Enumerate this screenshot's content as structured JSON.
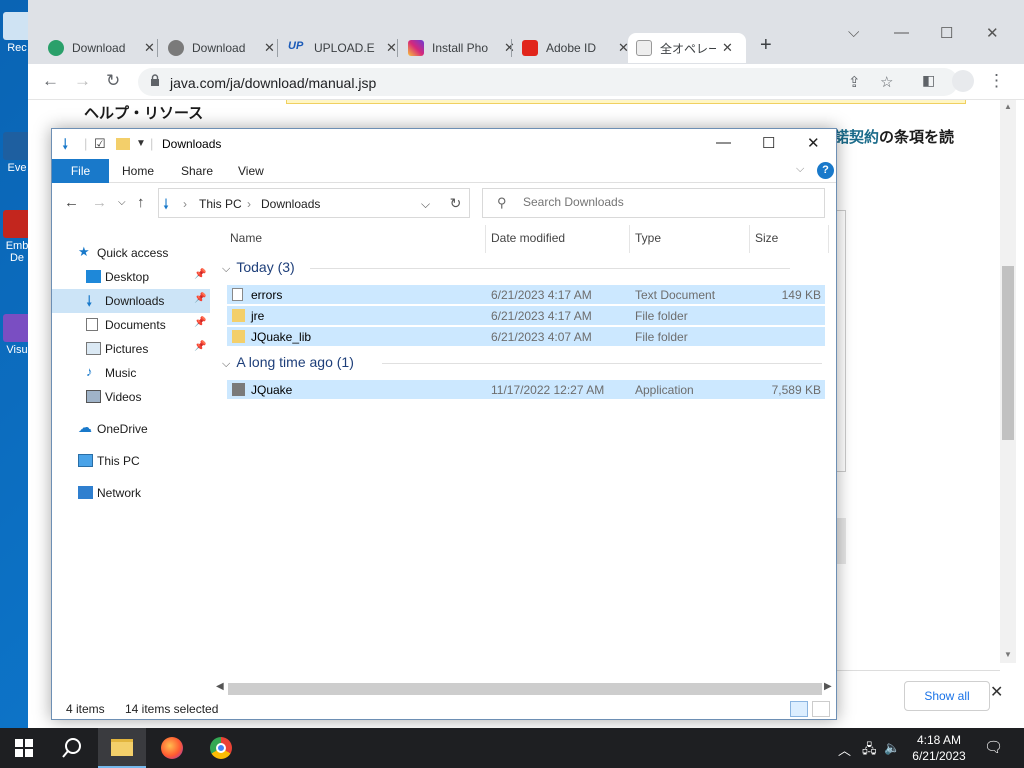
{
  "desktop": {
    "icons": [
      {
        "label": "Rec"
      },
      {
        "label": "Eve"
      },
      {
        "label": "Emb De"
      },
      {
        "label": "Visu"
      }
    ]
  },
  "browser": {
    "tabs": [
      {
        "label": "Download",
        "icon": "edge-icon",
        "color": "#2aa06a"
      },
      {
        "label": "Download",
        "icon": "wave-icon",
        "color": "#7a7a7a"
      },
      {
        "label": "UPLOAD.E",
        "icon": "up-icon",
        "color": "#1a5ab8"
      },
      {
        "label": "Install Pho",
        "icon": "instagram-icon",
        "color": "#d6287a"
      },
      {
        "label": "Adobe ID",
        "icon": "adobe-icon",
        "color": "#e1251b"
      },
      {
        "label": "全オペレー",
        "icon": "java-icon",
        "color": "#777777"
      }
    ],
    "url": "java.com/ja/download/manual.jsp",
    "page": {
      "help_heading": "ヘルプ・リソース",
      "terms_link": "諾契約",
      "terms_rest": "の条項を読",
      "show_all": "Show all"
    }
  },
  "explorer": {
    "title": "Downloads",
    "ribbon_tabs": [
      "File",
      "Home",
      "Share",
      "View"
    ],
    "breadcrumb": [
      "This PC",
      "Downloads"
    ],
    "search_placeholder": "Search Downloads",
    "nav": {
      "quick_access": "Quick access",
      "items": [
        {
          "label": "Desktop",
          "icon": "desktop-icon",
          "pinned": true
        },
        {
          "label": "Downloads",
          "icon": "download-icon",
          "pinned": true,
          "selected": true
        },
        {
          "label": "Documents",
          "icon": "documents-icon",
          "pinned": true
        },
        {
          "label": "Pictures",
          "icon": "pictures-icon",
          "pinned": true
        },
        {
          "label": "Music",
          "icon": "music-icon",
          "pinned": false
        },
        {
          "label": "Videos",
          "icon": "videos-icon",
          "pinned": false
        }
      ],
      "onedrive": "OneDrive",
      "this_pc": "This PC",
      "network": "Network"
    },
    "columns": [
      "Name",
      "Date modified",
      "Type",
      "Size"
    ],
    "groups": [
      {
        "title": "Today (3)",
        "files": [
          {
            "name": "errors",
            "date": "6/21/2023 4:17 AM",
            "type": "Text Document",
            "size": "149 KB",
            "icon": "text-file-icon"
          },
          {
            "name": "jre",
            "date": "6/21/2023 4:17 AM",
            "type": "File folder",
            "size": "",
            "icon": "folder-icon"
          },
          {
            "name": "JQuake_lib",
            "date": "6/21/2023 4:07 AM",
            "type": "File folder",
            "size": "",
            "icon": "folder-icon"
          }
        ]
      },
      {
        "title": "A long time ago (1)",
        "files": [
          {
            "name": "JQuake",
            "date": "11/17/2022 12:27 AM",
            "type": "Application",
            "size": "7,589 KB",
            "icon": "app-icon"
          }
        ]
      }
    ],
    "status": {
      "items": "4 items",
      "selected": "14 items selected"
    }
  },
  "taskbar": {
    "time": "4:18 AM",
    "date": "6/21/2023"
  }
}
